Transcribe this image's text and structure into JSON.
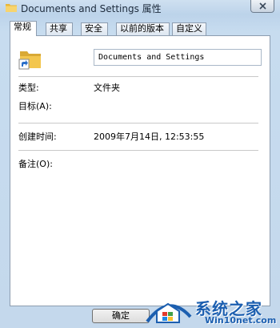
{
  "window": {
    "title": "Documents and Settings 属性",
    "close_icon": "close-icon"
  },
  "tabs": [
    {
      "label": "常规",
      "active": true
    },
    {
      "label": "共享",
      "active": false
    },
    {
      "label": "安全",
      "active": false
    },
    {
      "label": "以前的版本",
      "active": false
    },
    {
      "label": "自定义",
      "active": false
    }
  ],
  "general": {
    "name_value": "Documents and Settings",
    "type_label": "类型:",
    "type_value": "文件夹",
    "target_label": "目标(A):",
    "created_label": "创建时间:",
    "created_value": "2009年7月14日, 12:53:55",
    "comment_label": "备注(O):"
  },
  "buttons": {
    "ok_label": "确定"
  },
  "watermark": {
    "brand_cn": "系统之家",
    "url": "Win10net.com"
  },
  "colors": {
    "accent": "#1c5fb0",
    "folder": "#f3c64e",
    "shortcut_arrow": "#2a6fc9"
  }
}
